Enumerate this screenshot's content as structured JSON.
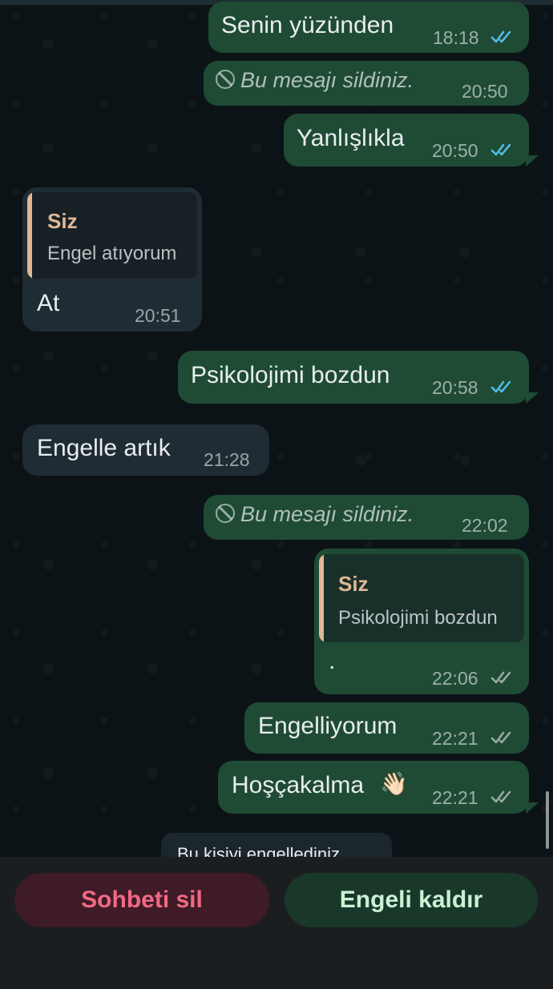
{
  "messages": [
    {
      "dir": "out",
      "text": "Senin yüzünden",
      "time": "18:18",
      "status": "read"
    },
    {
      "dir": "out",
      "deleted": true,
      "text": "Bu mesajı sildiniz.",
      "time": "20:50"
    },
    {
      "dir": "out",
      "text": "Yanlışlıkla",
      "time": "20:50",
      "status": "read"
    },
    {
      "dir": "in",
      "quote": {
        "name": "Siz",
        "text": "Engel atıyorum"
      },
      "text": "At",
      "time": "20:51"
    },
    {
      "dir": "out",
      "text": "Psikolojimi bozdun",
      "time": "20:58",
      "status": "read"
    },
    {
      "dir": "in",
      "text": "Engelle artık",
      "time": "21:28"
    },
    {
      "dir": "out",
      "deleted": true,
      "text": "Bu mesajı sildiniz.",
      "time": "22:02"
    },
    {
      "dir": "out",
      "quote": {
        "name": "Siz",
        "text": "Psikolojimi bozdun"
      },
      "text": ".",
      "time": "22:06",
      "status": "delivered"
    },
    {
      "dir": "out",
      "text": "Engelliyorum",
      "time": "22:21",
      "status": "delivered"
    },
    {
      "dir": "out",
      "text": "Hoşçakalma",
      "emoji": "👋🏻",
      "time": "22:21",
      "status": "delivered"
    }
  ],
  "notice": "Bu kişiyi engellediniz",
  "actions": {
    "delete_label": "Sohbeti sil",
    "unblock_label": "Engeli kaldır"
  },
  "colors": {
    "outgoing_bubble": "#1f4b34",
    "incoming_bubble": "#1f2c33",
    "read_ticks": "#53bdeb",
    "delete_text": "#f06a84"
  }
}
